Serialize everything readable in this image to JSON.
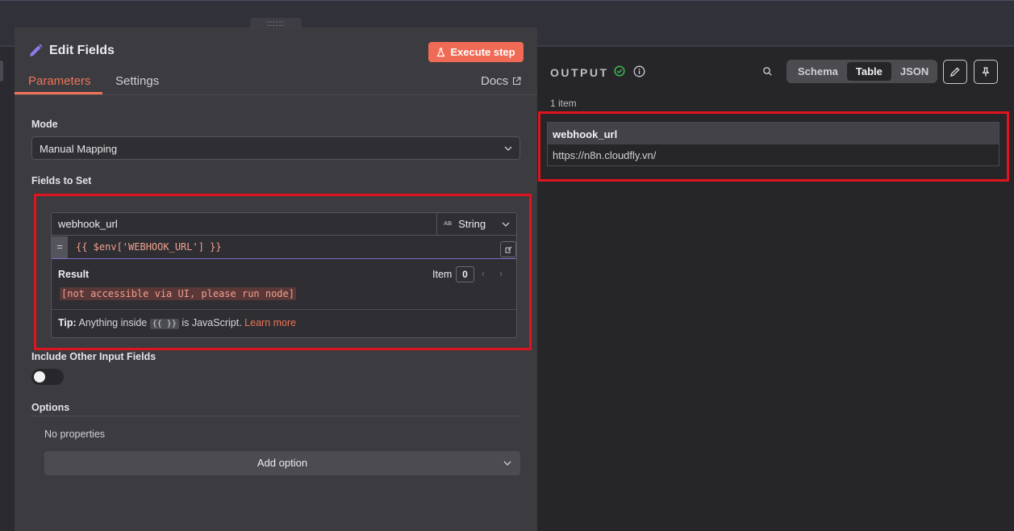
{
  "panel": {
    "title": "Edit Fields",
    "execute_label": "Execute step",
    "tabs": [
      {
        "label": "Parameters",
        "active": true
      },
      {
        "label": "Settings",
        "active": false
      }
    ],
    "docs_label": "Docs",
    "drag_handle": "::::::"
  },
  "mode": {
    "label": "Mode",
    "value": "Manual Mapping"
  },
  "fields": {
    "label": "Fields to Set",
    "name": "webhook_url",
    "type_badge": "AB",
    "type": "String",
    "eq": "=",
    "expression": "{{ $env['WEBHOOK_URL'] }}",
    "result_label": "Result",
    "item_label": "Item",
    "item_index": "0",
    "prev_arrow": "‹",
    "next_arrow": "›",
    "result_value": "[not accessible via UI, please run node]",
    "tip_bold": "Tip:",
    "tip_text": "Anything inside",
    "tip_code": "{{ }}",
    "tip_text2": "is JavaScript.",
    "tip_link": "Learn more"
  },
  "include": {
    "label": "Include Other Input Fields",
    "enabled": false
  },
  "options": {
    "label": "Options",
    "empty_text": "No properties",
    "add_label": "Add option"
  },
  "output": {
    "title": "OUTPUT",
    "views": [
      {
        "label": "Schema",
        "active": false
      },
      {
        "label": "Table",
        "active": true
      },
      {
        "label": "JSON",
        "active": false
      }
    ],
    "count": "1 item",
    "columns": [
      "webhook_url"
    ],
    "rows": [
      [
        "https://n8n.cloudfly.vn/"
      ]
    ]
  },
  "colors": {
    "accent": "#f07458",
    "execute_bg": "#f06b56",
    "highlight": "#e0141e",
    "success": "#3fb950"
  }
}
